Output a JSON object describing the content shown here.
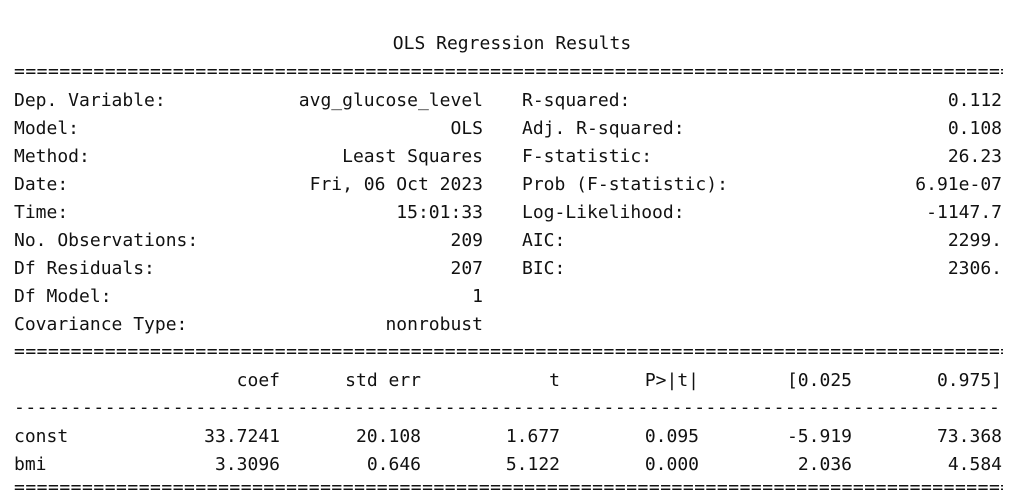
{
  "title": "OLS Regression Results",
  "rules": {
    "double": "=============================================================================================================================",
    "single": "-----------------------------------------------------------------------------------------------------------------------------"
  },
  "summary": [
    {
      "label1": "Dep. Variable:",
      "value1": "avg_glucose_level",
      "label2": "R-squared:",
      "value2": "0.112"
    },
    {
      "label1": "Model:",
      "value1": "OLS",
      "label2": "Adj. R-squared:",
      "value2": "0.108"
    },
    {
      "label1": "Method:",
      "value1": "Least Squares",
      "label2": "F-statistic:",
      "value2": "26.23"
    },
    {
      "label1": "Date:",
      "value1": "Fri, 06 Oct 2023",
      "label2": "Prob (F-statistic):",
      "value2": "6.91e-07"
    },
    {
      "label1": "Time:",
      "value1": "15:01:33",
      "label2": "Log-Likelihood:",
      "value2": "-1147.7"
    },
    {
      "label1": "No. Observations:",
      "value1": "209",
      "label2": "AIC:",
      "value2": "2299."
    },
    {
      "label1": "Df Residuals:",
      "value1": "207",
      "label2": "BIC:",
      "value2": "2306."
    },
    {
      "label1": "Df Model:",
      "value1": "1",
      "label2": "",
      "value2": ""
    },
    {
      "label1": "Covariance Type:",
      "value1": "nonrobust",
      "label2": "",
      "value2": ""
    }
  ],
  "coef_table": {
    "headers": [
      "coef",
      "std err",
      "t",
      "P>|t|",
      "[0.025",
      "0.975]"
    ],
    "rows": [
      {
        "name": "const",
        "values": [
          "33.7241",
          "20.108",
          "1.677",
          "0.095",
          "-5.919",
          "73.368"
        ]
      },
      {
        "name": "bmi",
        "values": [
          "3.3096",
          "0.646",
          "5.122",
          "0.000",
          "2.036",
          "4.584"
        ]
      }
    ]
  }
}
